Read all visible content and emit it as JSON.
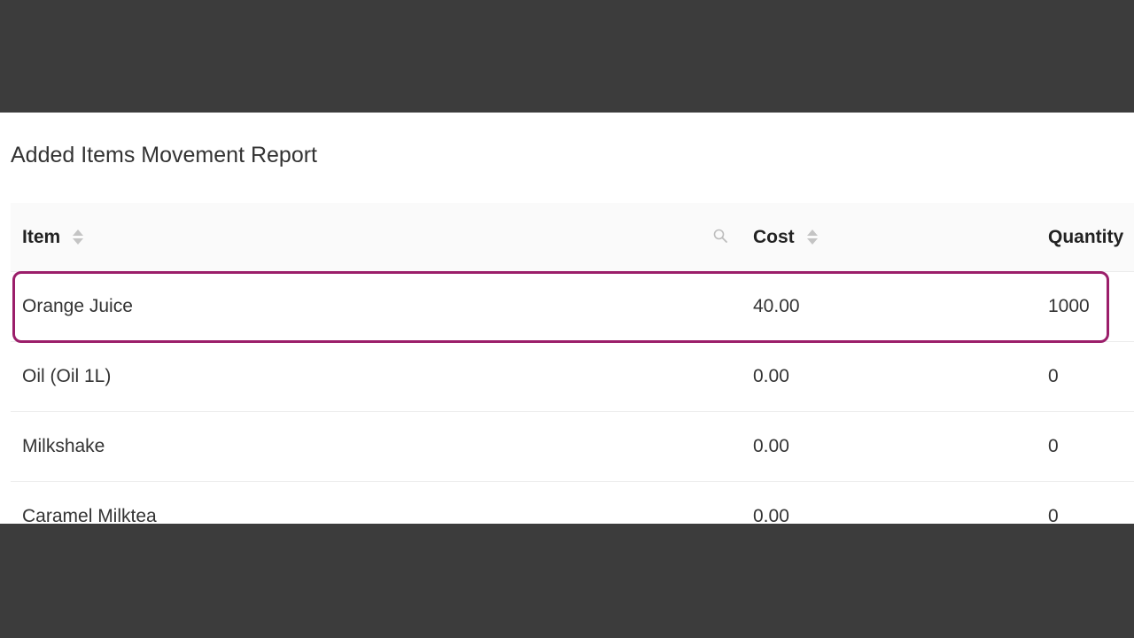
{
  "report": {
    "title": "Added Items Movement Report"
  },
  "table": {
    "columns": {
      "item": "Item",
      "cost": "Cost",
      "quantity": "Quantity"
    },
    "rows": [
      {
        "item": "Orange Juice",
        "cost": "40.00",
        "quantity": "1000"
      },
      {
        "item": "Oil (Oil 1L)",
        "cost": "0.00",
        "quantity": "0"
      },
      {
        "item": "Milkshake",
        "cost": "0.00",
        "quantity": "0"
      },
      {
        "item": "Caramel Milktea",
        "cost": "0.00",
        "quantity": "0"
      }
    ]
  },
  "highlight": {
    "color": "#9b1e6a",
    "row": "Orange Juice"
  },
  "icons": {
    "search": "search-icon",
    "sort": "sort-icon"
  }
}
